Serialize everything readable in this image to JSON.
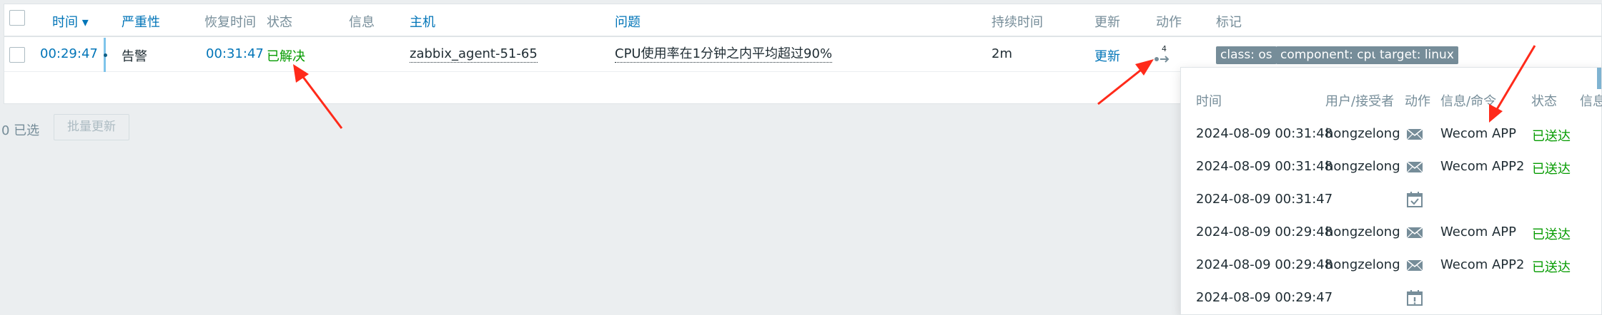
{
  "table": {
    "headers": {
      "time": "时间 ▾",
      "severity": "严重性",
      "recovery_time": "恢复时间",
      "status": "状态",
      "info": "信息",
      "host": "主机",
      "problem": "问题",
      "duration": "持续时间",
      "update": "更新",
      "actions": "动作",
      "tags": "标记"
    },
    "row": {
      "time": "00:29:47",
      "severity": "告警",
      "recovery_time": "00:31:47",
      "status": "已解决",
      "host": "zabbix_agent-51-65",
      "problem": "CPU使用率在1分钟之内平均超过90%",
      "duration": "2m",
      "update": "更新",
      "actions_count": "4",
      "tags": [
        "class: os",
        "component: cpu",
        "target: linux"
      ]
    }
  },
  "footer": {
    "selected": "0 已选",
    "bulk_update": "批量更新"
  },
  "popup": {
    "headers": {
      "time": "时间",
      "user": "用户/接受者",
      "action": "动作",
      "message": "信息/命令",
      "status": "状态",
      "info": "信息"
    },
    "rows": [
      {
        "time": "2024-08-09 00:31:48",
        "user": "hongzelong",
        "icon": "envelope-icon",
        "message": "Wecom APP",
        "status": "已送达"
      },
      {
        "time": "2024-08-09 00:31:48",
        "user": "hongzelong",
        "icon": "envelope-icon",
        "message": "Wecom APP2",
        "status": "已送达"
      },
      {
        "time": "2024-08-09 00:31:47",
        "user": "",
        "icon": "calendar-check-icon",
        "message": "",
        "status": ""
      },
      {
        "time": "2024-08-09 00:29:48",
        "user": "hongzelong",
        "icon": "envelope-icon",
        "message": "Wecom APP",
        "status": "已送达"
      },
      {
        "time": "2024-08-09 00:29:48",
        "user": "hongzelong",
        "icon": "envelope-icon",
        "message": "Wecom APP2",
        "status": "已送达"
      },
      {
        "time": "2024-08-09 00:29:47",
        "user": "",
        "icon": "calendar-alert-icon",
        "message": "",
        "status": ""
      }
    ]
  },
  "colors": {
    "link": "#0275b8",
    "resolved": "#059b00",
    "tag_bg": "#768d99",
    "arrow": "#ff2a1a"
  }
}
